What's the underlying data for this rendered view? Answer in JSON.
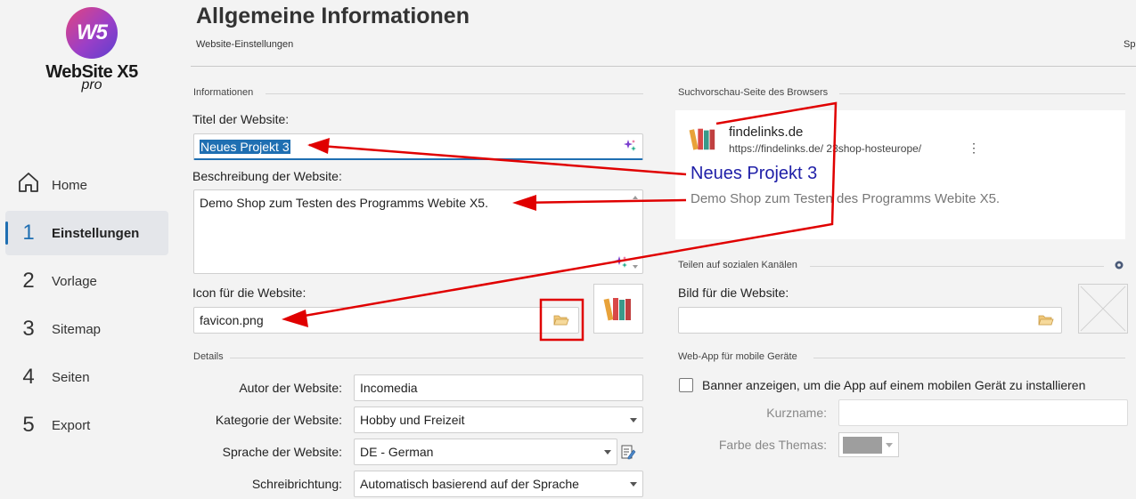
{
  "app": {
    "logo_text": "WebSite X5",
    "logo_sub": "pro",
    "logo_mark": "W5"
  },
  "sidebar": {
    "items": [
      {
        "num": "",
        "label": "Home",
        "icon": "home-icon"
      },
      {
        "num": "1",
        "label": "Einstellungen",
        "active": true
      },
      {
        "num": "2",
        "label": "Vorlage"
      },
      {
        "num": "3",
        "label": "Sitemap"
      },
      {
        "num": "4",
        "label": "Seiten"
      },
      {
        "num": "5",
        "label": "Export"
      }
    ]
  },
  "header": {
    "title": "Allgemeine Informationen",
    "subtitle": "Website-Einstellungen",
    "right_truncated": "Sp"
  },
  "info": {
    "section_label": "Informationen",
    "title_label": "Titel der Website:",
    "title_value": "Neues Projekt 3",
    "desc_label": "Beschreibung der Website:",
    "desc_value": "Demo Shop zum Testen des Programms Webite X5.",
    "icon_label": "Icon für die Website:",
    "icon_value": "favicon.png"
  },
  "details": {
    "section_label": "Details",
    "author_label": "Autor der Website:",
    "author_value": "Incomedia",
    "category_label": "Kategorie der Website:",
    "category_value": "Hobby und Freizeit",
    "language_label": "Sprache der Website:",
    "language_value": "DE - German",
    "direction_label": "Schreibrichtung:",
    "direction_value": "Automatisch basierend auf der Sprache"
  },
  "preview": {
    "section_label": "Suchvorschau-Seite des Browsers",
    "site_name": "findelinks.de",
    "url": "https://findelinks.de/ 23shop-hosteurope/",
    "menu": "⋮",
    "title": "Neues Projekt 3",
    "description": "Demo Shop zum Testen des Programms Webite X5."
  },
  "social": {
    "section_label": "Teilen auf sozialen Kanälen",
    "image_label": "Bild für die Website:",
    "image_value": ""
  },
  "webapp": {
    "section_label": "Web-App für mobile Geräte",
    "banner_label": "Banner anzeigen, um die App auf einem mobilen Gerät zu installieren",
    "banner_checked": false,
    "shortname_label": "Kurzname:",
    "shortname_value": "",
    "theme_label": "Farbe des Themas:",
    "theme_color": "#9e9e9e"
  },
  "colors": {
    "accent": "#1f6fb2",
    "annotation": "#e00000",
    "preview_title": "#2020a8"
  }
}
